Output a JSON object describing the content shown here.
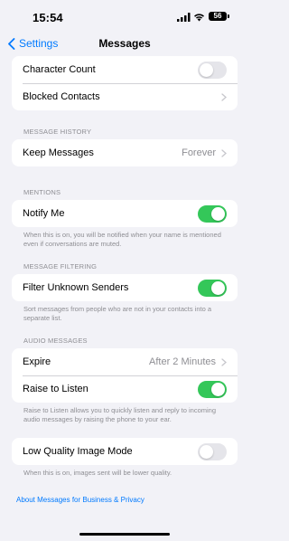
{
  "status_bar": {
    "time": "15:54",
    "battery": "56"
  },
  "nav": {
    "back_label": "Settings",
    "title": "Messages"
  },
  "top_group": {
    "character_count": {
      "label": "Character Count",
      "on": false
    },
    "blocked_contacts": {
      "label": "Blocked Contacts"
    }
  },
  "message_history": {
    "header": "MESSAGE HISTORY",
    "keep_messages": {
      "label": "Keep Messages",
      "value": "Forever"
    }
  },
  "mentions": {
    "header": "MENTIONS",
    "notify_me": {
      "label": "Notify Me",
      "on": true
    },
    "footer": "When this is on, you will be notified when your name is mentioned even if conversations are muted."
  },
  "message_filtering": {
    "header": "MESSAGE FILTERING",
    "filter_unknown": {
      "label": "Filter Unknown Senders",
      "on": true
    },
    "footer": "Sort messages from people who are not in your contacts into a separate list."
  },
  "audio_messages": {
    "header": "AUDIO MESSAGES",
    "expire": {
      "label": "Expire",
      "value": "After 2 Minutes"
    },
    "raise_to_listen": {
      "label": "Raise to Listen",
      "on": true
    },
    "footer": "Raise to Listen allows you to quickly listen and reply to incoming audio messages by raising the phone to your ear."
  },
  "low_quality": {
    "label": "Low Quality Image Mode",
    "on": false,
    "footer": "When this is on, images sent will be lower quality."
  },
  "about_link": "About Messages for Business & Privacy",
  "colors": {
    "accent": "#007aff",
    "switch_on": "#34c759",
    "switch_off": "#e5e5ea",
    "background": "#f2f2f7"
  }
}
